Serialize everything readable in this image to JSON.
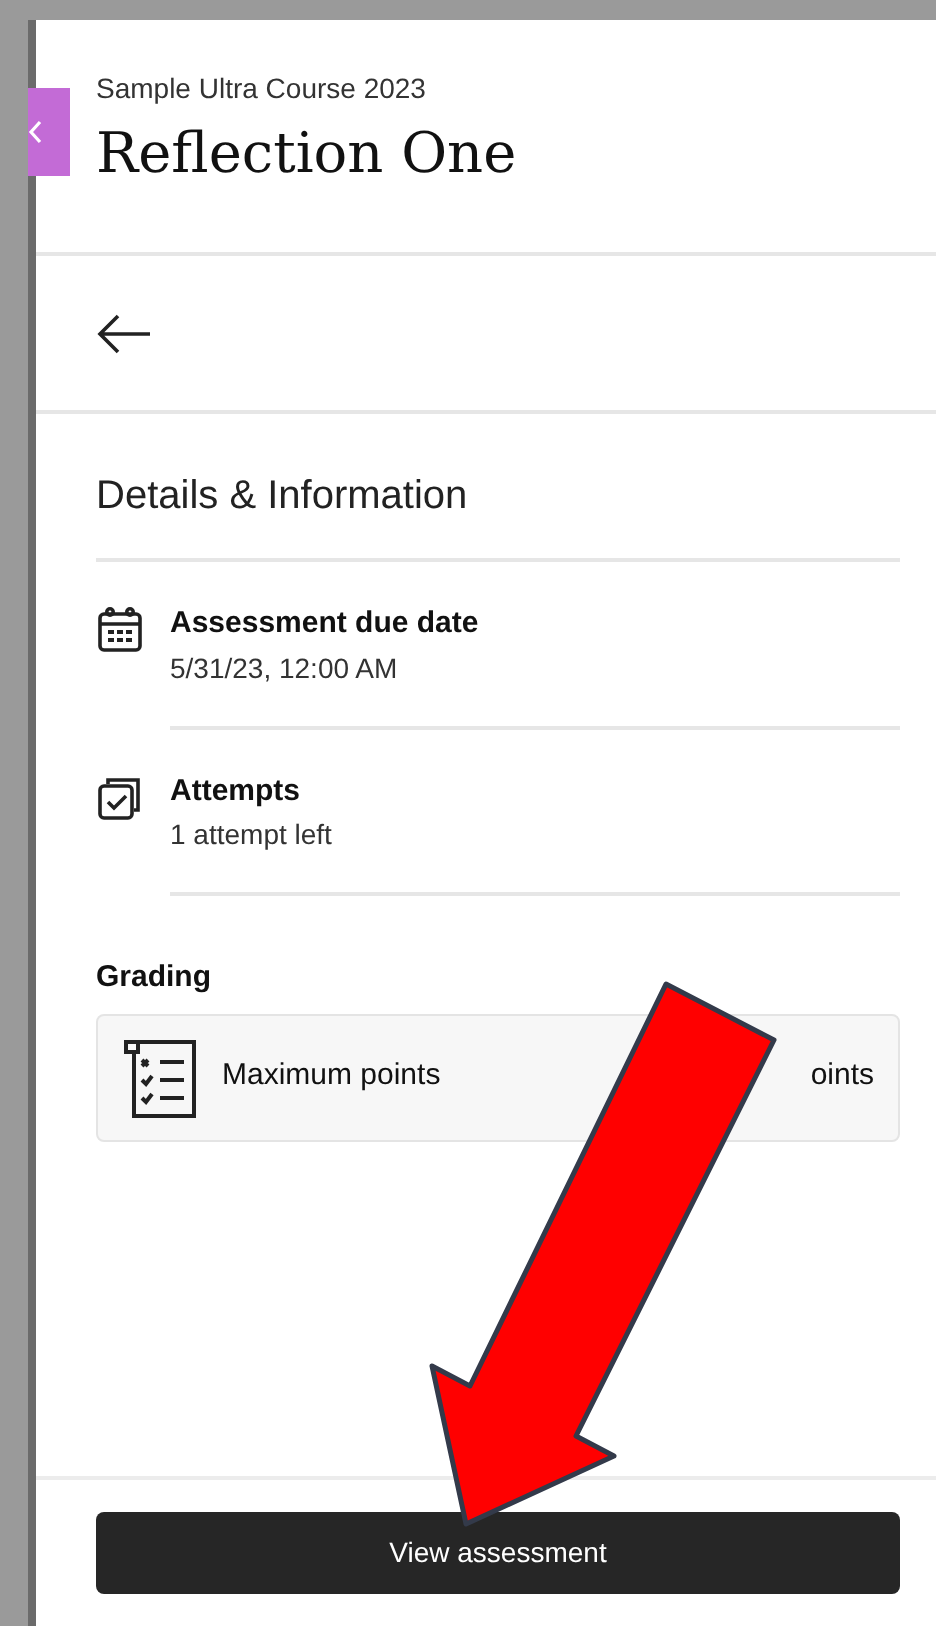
{
  "header": {
    "course": "Sample Ultra Course 2023",
    "title": "Reflection One"
  },
  "details": {
    "heading": "Details & Information",
    "items": [
      {
        "kind": "calendar",
        "label": "Assessment due date",
        "value": "5/31/23, 12:00 AM"
      },
      {
        "kind": "attempts",
        "label": "Attempts",
        "value": "1 attempt left"
      }
    ]
  },
  "grading": {
    "heading": "Grading",
    "label": "Maximum points",
    "value": "oints"
  },
  "footer": {
    "button": "View assessment"
  }
}
